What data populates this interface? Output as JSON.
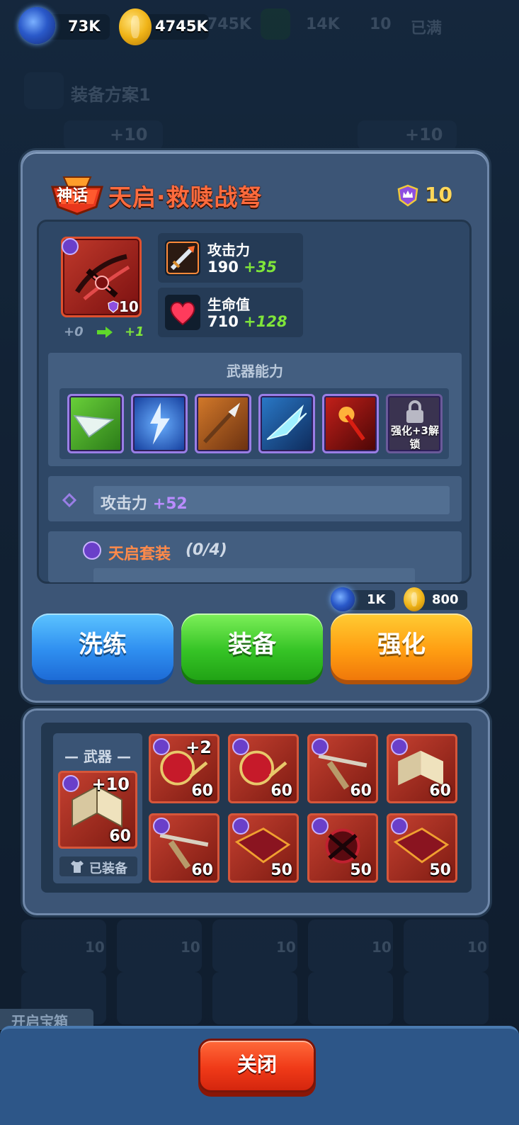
{
  "currency": {
    "energy": "73K",
    "gold": "4745K",
    "bg_res1": "745K",
    "bg_res2": "14K",
    "bg_res3": "10",
    "bg_full": "已满"
  },
  "background": {
    "loadout": "装备方案1",
    "slot_bonus": "+10",
    "slot_level": "10",
    "open_chest": "开启宝箱"
  },
  "item": {
    "rarity_badge": "神话",
    "name": "天启·救赎战弩",
    "level": "10",
    "icon_level": "10",
    "upgrade_from": "+0",
    "upgrade_to": "+1",
    "stats": [
      {
        "name": "攻击力",
        "value": "190",
        "bonus": "+35",
        "icon": "sword-icon"
      },
      {
        "name": "生命值",
        "value": "710",
        "bonus": "+128",
        "icon": "heart-icon"
      }
    ],
    "abilities_title": "武器能力",
    "locked_ability": "强化+3解锁",
    "extra_attr_name": "攻击力",
    "extra_attr_bonus": "+52",
    "set_name": "天启套装",
    "set_progress": "(0/4)"
  },
  "cost": {
    "energy": "1K",
    "gold": "800"
  },
  "buttons": {
    "reforge": "洗练",
    "equip": "装备",
    "enhance": "强化",
    "close": "关闭"
  },
  "inventory": {
    "equipped_label": "武器",
    "equipped_plus": "+10",
    "equipped_level": "60",
    "equipped_status": "已装备",
    "items": [
      {
        "plus": "+2",
        "level": "60"
      },
      {
        "plus": "",
        "level": "60"
      },
      {
        "plus": "",
        "level": "60"
      },
      {
        "plus": "",
        "level": "60"
      },
      {
        "plus": "",
        "level": "60"
      },
      {
        "plus": "",
        "level": "50"
      },
      {
        "plus": "",
        "level": "50"
      },
      {
        "plus": "",
        "level": "50"
      }
    ]
  },
  "colors": {
    "mythic": "#ff6b3d",
    "bonus": "#7fe53a",
    "level_gold": "#ffd75a",
    "purple": "#b98cff"
  }
}
